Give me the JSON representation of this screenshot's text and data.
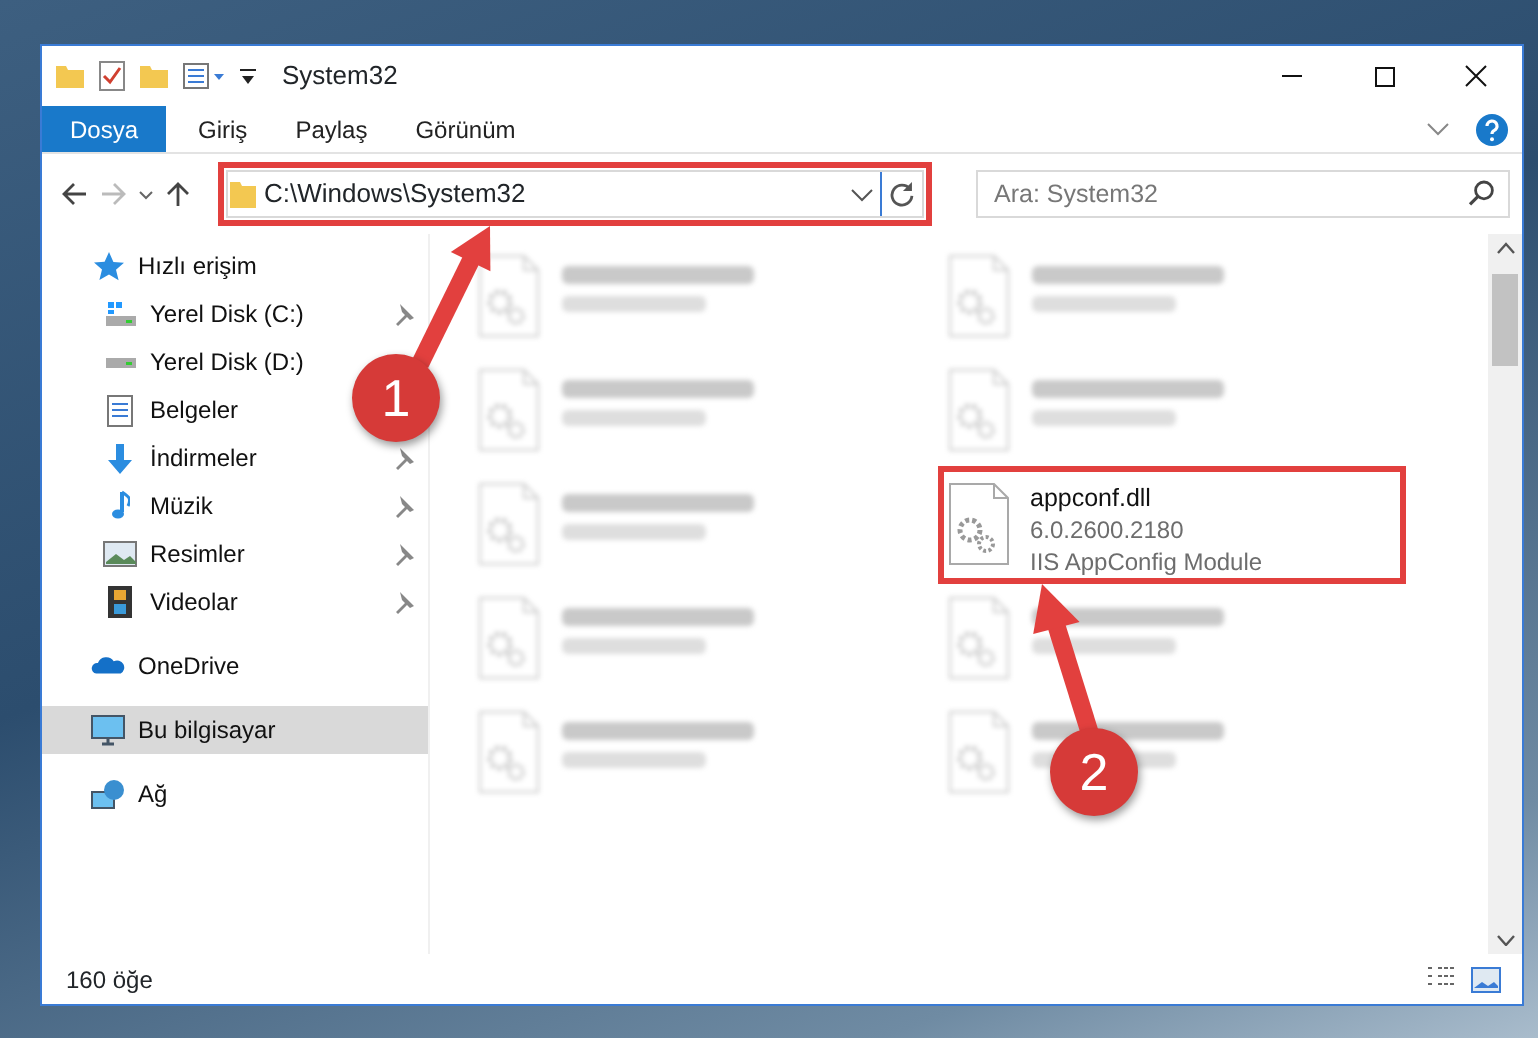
{
  "window": {
    "title": "System32"
  },
  "ribbon_tabs": [
    {
      "label": "Dosya",
      "selected": true
    },
    {
      "label": "Giriş",
      "selected": false
    },
    {
      "label": "Paylaş",
      "selected": false
    },
    {
      "label": "Görünüm",
      "selected": false
    }
  ],
  "address_bar": {
    "path": "C:\\Windows\\System32"
  },
  "search": {
    "placeholder": "Ara: System32"
  },
  "sidebar": {
    "items": [
      {
        "label": "Hızlı erişim",
        "kind": "quick",
        "selected": false,
        "children": [
          {
            "label": "Yerel Disk (C:)",
            "kind": "drive-c",
            "pinned": true
          },
          {
            "label": "Yerel Disk (D:)",
            "kind": "drive",
            "pinned": false
          },
          {
            "label": "Belgeler",
            "kind": "docs",
            "pinned": false
          },
          {
            "label": "İndirmeler",
            "kind": "downloads",
            "pinned": true
          },
          {
            "label": "Müzik",
            "kind": "music",
            "pinned": true
          },
          {
            "label": "Resimler",
            "kind": "pictures",
            "pinned": true
          },
          {
            "label": "Videolar",
            "kind": "videos",
            "pinned": true
          }
        ]
      },
      {
        "label": "OneDrive",
        "kind": "onedrive",
        "selected": false
      },
      {
        "label": "Bu bilgisayar",
        "kind": "pc",
        "selected": true
      },
      {
        "label": "Ağ",
        "kind": "network",
        "selected": false
      }
    ]
  },
  "files": [
    {
      "kind": "blurred"
    },
    {
      "kind": "blurred"
    },
    {
      "kind": "blurred"
    },
    {
      "kind": "blurred"
    },
    {
      "kind": "blurred"
    },
    {
      "kind": "file",
      "name": "appconf.dll",
      "details": [
        "6.0.2600.2180",
        "IIS AppConfig Module"
      ],
      "highlighted": true
    },
    {
      "kind": "blurred"
    },
    {
      "kind": "blurred"
    },
    {
      "kind": "blurred"
    },
    {
      "kind": "blurred"
    }
  ],
  "status_bar": {
    "item_count": "160 öğe"
  },
  "annotations": [
    {
      "number": "1"
    },
    {
      "number": "2"
    }
  ]
}
